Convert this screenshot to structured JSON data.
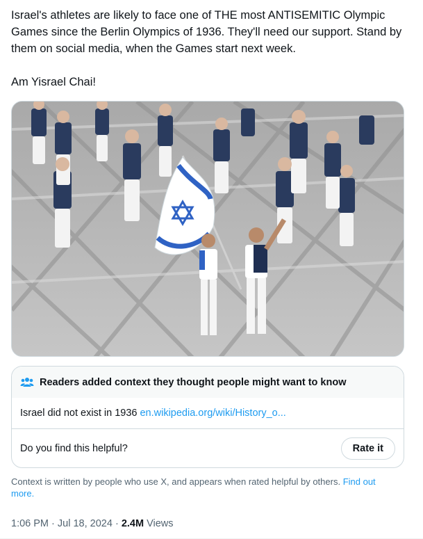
{
  "tweet": {
    "text_line_1": "Israel's athletes are likely to face one of THE most ANTISEMITIC Olympic Games since the Berlin Olympics of 1936. They'll need our support. Stand by them on social media, when the Games start next week.",
    "text_line_2": "Am Yisrael Chai!"
  },
  "media": {
    "icon": "photo"
  },
  "community_note": {
    "icon": "people-icon",
    "title": "Readers added context they thought people might want to know",
    "note_text": "Israel did not exist in 1936",
    "note_link": "en.wikipedia.org/wiki/History_o...",
    "helpful_prompt": "Do you find this helpful?",
    "rate_label": "Rate it"
  },
  "context_footer": {
    "text": "Context is written by people who use X, and appears when rated helpful by others.",
    "link": "Find out more."
  },
  "meta": {
    "time": "1:06 PM",
    "separator1": "·",
    "date": "Jul 18, 2024",
    "separator2": "·",
    "views_count": "2.4M",
    "views_label": "Views"
  },
  "colors": {
    "accent": "#1d9bf0",
    "secondary_text": "#536471",
    "primary_text": "#0f1419",
    "border": "#cfd9de"
  }
}
